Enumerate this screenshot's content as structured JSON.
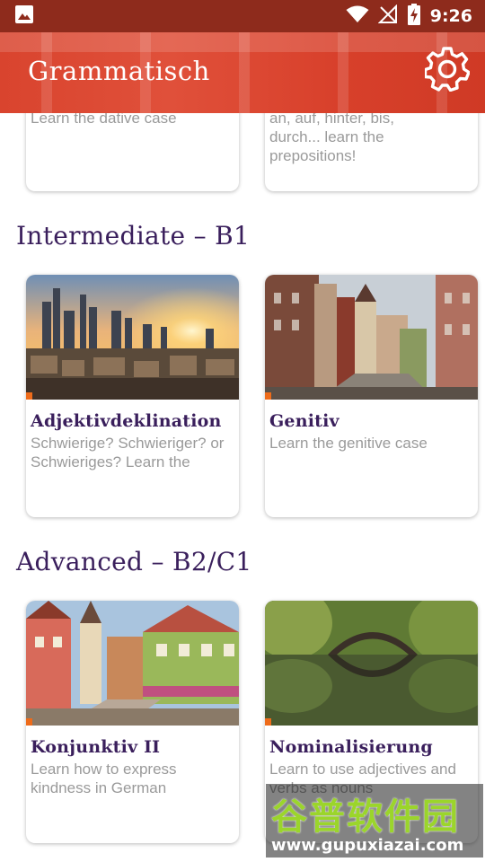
{
  "status_bar": {
    "time": "9:26"
  },
  "app_bar": {
    "title": "Grammatisch",
    "settings_icon": "gear-icon"
  },
  "top_cards": [
    {
      "desc": "Learn the dative case"
    },
    {
      "desc": "an, auf, hinter, bis, durch... learn the prepositions!"
    }
  ],
  "sections": [
    {
      "title": "Intermediate – B1",
      "cards": [
        {
          "title": "Adjektivdeklination",
          "desc": "Schwierige? Schwieriger? or Schwieriges? Learn the",
          "image": "city-skyline-sunset"
        },
        {
          "title": "Genitiv",
          "desc": "Learn the genitive case",
          "image": "old-town-street"
        }
      ]
    },
    {
      "title": "Advanced – B2/C1",
      "cards": [
        {
          "title": "Konjunktiv II",
          "desc": "Learn how to express kindness in German",
          "image": "timbered-houses-tower"
        },
        {
          "title": "Nominalisierung",
          "desc": "Learn to use adjectives and verbs as nouns",
          "image": "stone-bridge-lake"
        }
      ]
    }
  ],
  "watermark": {
    "big": "谷普软件园",
    "url": "www.gupuxiazai.com"
  },
  "colors": {
    "accent": "#ee6b1a",
    "title": "#3a1f5c",
    "appbar": "#d9442e",
    "statusbar": "#8e2b1c"
  }
}
